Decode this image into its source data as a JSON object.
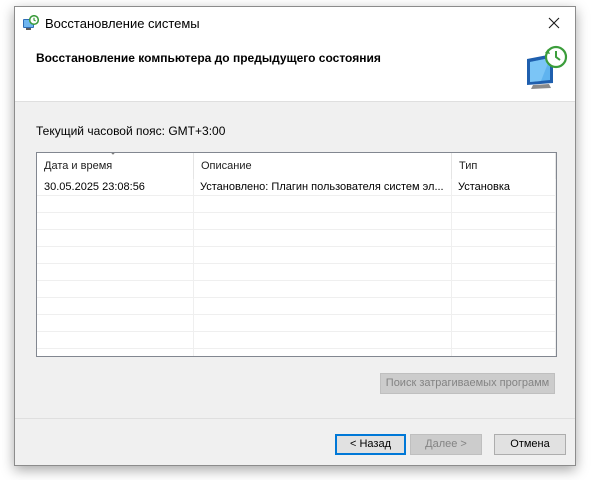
{
  "window": {
    "title": "Восстановление системы",
    "header_title": "Восстановление компьютера до предыдущего состояния"
  },
  "timezone": {
    "label": "Текущий часовой пояс: GMT+3:00"
  },
  "restore_points": {
    "columns": [
      "Дата и время",
      "Описание",
      "Тип"
    ],
    "rows": [
      {
        "date": "30.05.2025 23:08:56",
        "description": "Установлено: Плагин пользователя систем эл...",
        "type": "Установка"
      }
    ]
  },
  "buttons": {
    "scan": "Поиск затрагиваемых программ",
    "back": "< Назад",
    "next": "Далее >",
    "cancel": "Отмена"
  },
  "icons": {
    "title": "system-restore-icon",
    "close": "close-icon",
    "header": "restore-computer-icon",
    "sort": "sort-arrow-icon"
  },
  "colors": {
    "accent": "#0078d7",
    "window_bg": "#f0f0f0",
    "disabled_button": "#cccccc"
  }
}
